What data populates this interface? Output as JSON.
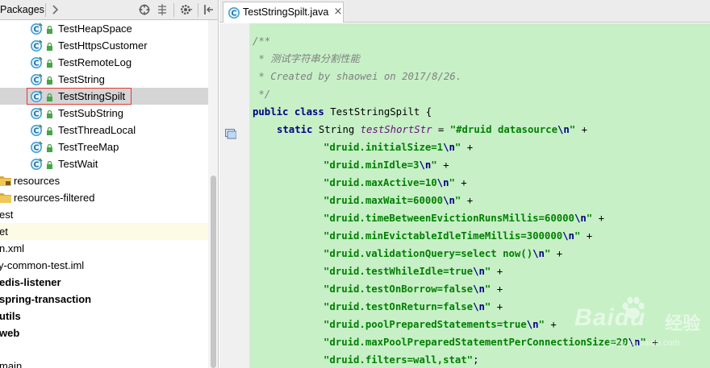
{
  "project_panel": {
    "title": "Packages",
    "toolbar_icons": [
      "chevron-right-icon",
      "locate-icon",
      "collapse-icon",
      "gear-icon",
      "hide-panel-icon"
    ],
    "tree": [
      {
        "label": "TestHeapSpace",
        "kind": "class"
      },
      {
        "label": "TestHttpsCustomer",
        "kind": "class"
      },
      {
        "label": "TestRemoteLog",
        "kind": "class"
      },
      {
        "label": "TestString",
        "kind": "class"
      },
      {
        "label": "TestStringSpilt",
        "kind": "class",
        "selected": true
      },
      {
        "label": "TestSubString",
        "kind": "class"
      },
      {
        "label": "TestThreadLocal",
        "kind": "class"
      },
      {
        "label": "TestTreeMap",
        "kind": "class"
      },
      {
        "label": "TestWait",
        "kind": "class"
      },
      {
        "label": "resources",
        "kind": "folder"
      },
      {
        "label": "resources-filtered",
        "kind": "folder"
      },
      {
        "label": "est",
        "kind": "text"
      },
      {
        "label": "et",
        "kind": "text",
        "current": true
      },
      {
        "label": "n.xml",
        "kind": "text"
      },
      {
        "label": "y-common-test.iml",
        "kind": "text"
      },
      {
        "label": "edis-listener",
        "kind": "module"
      },
      {
        "label": "spring-transaction",
        "kind": "module"
      },
      {
        "label": "utils",
        "kind": "module"
      },
      {
        "label": "web",
        "kind": "module"
      },
      {
        "label": "",
        "kind": "text"
      },
      {
        "label": "main",
        "kind": "text"
      }
    ]
  },
  "editor": {
    "tab": {
      "label": "TestStringSpilt.java",
      "close": "×"
    },
    "code": {
      "doc_open": "/**",
      "doc_line1": " * 测试字符串分割性能",
      "doc_line2": " * Created by shaowei on 2017/8/26.",
      "doc_close": " */",
      "class_kw": "public class ",
      "class_name": "TestStringSpilt {",
      "static_kw": "static ",
      "field_type": "String ",
      "field_name": "testShortStr",
      "assign": " = ",
      "plus": " +",
      "first_string": "\"#druid datasource",
      "newline_escape": "\\n",
      "quote": "\"",
      "strings": [
        "\"druid.initialSize=1",
        "\"druid.minIdle=3",
        "\"druid.maxActive=10",
        "\"druid.maxWait=60000",
        "\"druid.timeBetweenEvictionRunsMillis=60000",
        "\"druid.minEvictableIdleTimeMillis=300000",
        "\"druid.validationQuery=select now()",
        "\"druid.testWhileIdle=true",
        "\"druid.testOnBorrow=false",
        "\"druid.testOnReturn=false",
        "\"druid.poolPreparedStatements=true",
        "\"druid.maxPoolPreparedStatementPerConnectionSize=20"
      ],
      "last_string": "\"druid.filters=wall,stat\"",
      "semicolon": ";"
    }
  },
  "watermark": {
    "brand": "Bai",
    "paw": "du",
    "suffix": "经验",
    "url": "jingyan.baidu.com"
  },
  "colors": {
    "code_background": "#c7f0c7",
    "comment": "#808080",
    "keyword": "#000080",
    "field": "#660e7a",
    "string": "#008000",
    "selection": "#d5d5d5",
    "highlight_border": "#e03a3a"
  }
}
